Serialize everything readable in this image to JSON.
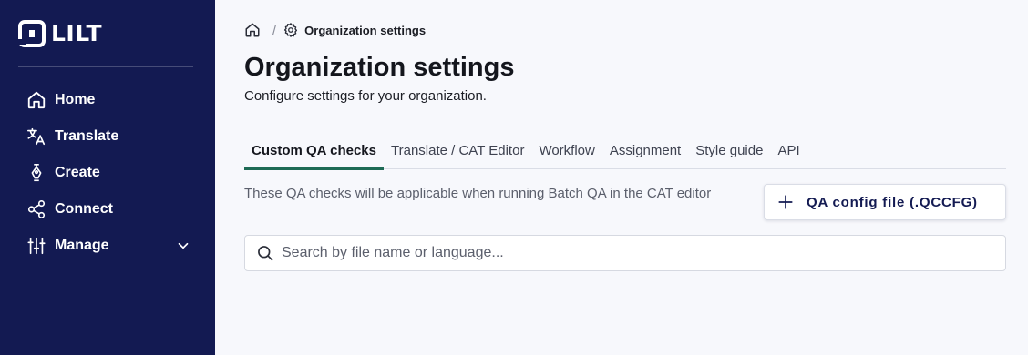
{
  "app": {
    "logo_text": "LILT"
  },
  "sidebar": {
    "items": [
      {
        "label": "Home",
        "icon": "home-icon"
      },
      {
        "label": "Translate",
        "icon": "translate-icon"
      },
      {
        "label": "Create",
        "icon": "pen-nib-icon"
      },
      {
        "label": "Connect",
        "icon": "share-nodes-icon"
      },
      {
        "label": "Manage",
        "icon": "sliders-icon",
        "expandable": true
      }
    ]
  },
  "breadcrumb": {
    "current": "Organization settings",
    "separator": "/"
  },
  "page": {
    "title": "Organization settings",
    "subtitle": "Configure settings for your organization."
  },
  "tabs": [
    {
      "label": "Custom QA checks",
      "active": true
    },
    {
      "label": "Translate / CAT Editor",
      "active": false
    },
    {
      "label": "Workflow",
      "active": false
    },
    {
      "label": "Assignment",
      "active": false
    },
    {
      "label": "Style guide",
      "active": false
    },
    {
      "label": "API",
      "active": false
    }
  ],
  "qa": {
    "description": "These QA checks will be applicable when running Batch QA in the CAT editor",
    "add_button_label": "QA config file (.QCCFG)",
    "search_placeholder": "Search by file name or language..."
  },
  "colors": {
    "sidebar_bg": "#131a52",
    "page_bg": "#f7f8fc",
    "tab_active_underline": "#1e6a55"
  }
}
